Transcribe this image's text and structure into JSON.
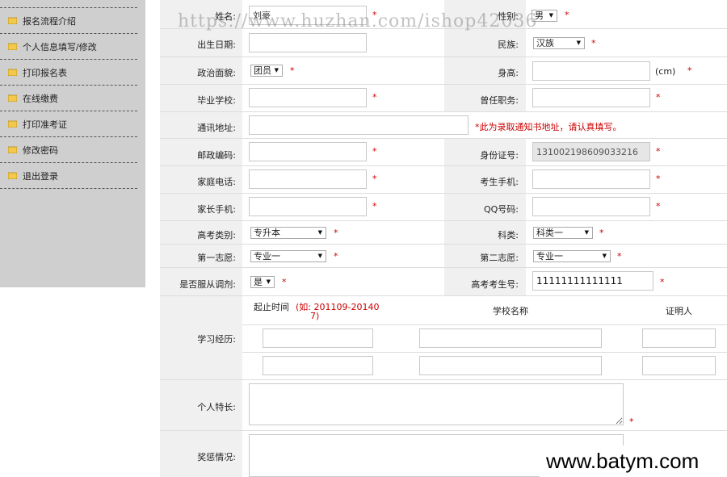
{
  "sidebar": {
    "items": [
      {
        "label": "报名流程介绍"
      },
      {
        "label": "个人信息填写/修改"
      },
      {
        "label": "打印报名表"
      },
      {
        "label": "在线缴费"
      },
      {
        "label": "打印准考证"
      },
      {
        "label": "修改密码"
      },
      {
        "label": "退出登录"
      }
    ]
  },
  "form": {
    "name_label": "姓名:",
    "name_value": "刘豪",
    "gender_label": "性别:",
    "gender_value": "男",
    "birth_label": "出生日期:",
    "ethnic_label": "民族:",
    "ethnic_value": "汉族",
    "politics_label": "政治面貌:",
    "politics_value": "团员",
    "height_label": "身高:",
    "height_unit": "(cm)",
    "school_label": "毕业学校:",
    "position_label": "曾任职务:",
    "address_label": "通讯地址:",
    "address_note": "*此为录取通知书地址，请认真填写。",
    "zip_label": "邮政编码:",
    "idcard_label": "身份证号:",
    "idcard_value": "131002198609033216",
    "homephone_label": "家庭电话:",
    "mobile_label": "考生手机:",
    "parentphone_label": "家长手机:",
    "qq_label": "QQ号码:",
    "exam_type_label": "高考类别:",
    "exam_type_value": "专升本",
    "subject_label": "科类:",
    "subject_value": "科类一",
    "choice1_label": "第一志愿:",
    "choice1_value": "专业一",
    "choice2_label": "第二志愿:",
    "choice2_value": "专业一",
    "adjust_label": "是否服从调剂:",
    "adjust_value": "是",
    "examno_label": "高考考生号:",
    "examno_value": "11111111111111",
    "edu_label": "学习经历:",
    "edu_col1": "起止时间",
    "edu_col1_hint": "(如: 201109-20140",
    "edu_col1_hint2": "7)",
    "edu_col2": "学校名称",
    "edu_col3": "证明人",
    "skill_label": "个人特长:",
    "award_label": "奖惩情况:",
    "required_mark": "*"
  },
  "watermark": "https://www.huzhan.com/ishop42036",
  "brand": "www.batym.com",
  "colors": {
    "required": "#cc0000",
    "label_bg": "#f0f0f0",
    "sidebar_bg": "#cfcfcf"
  }
}
